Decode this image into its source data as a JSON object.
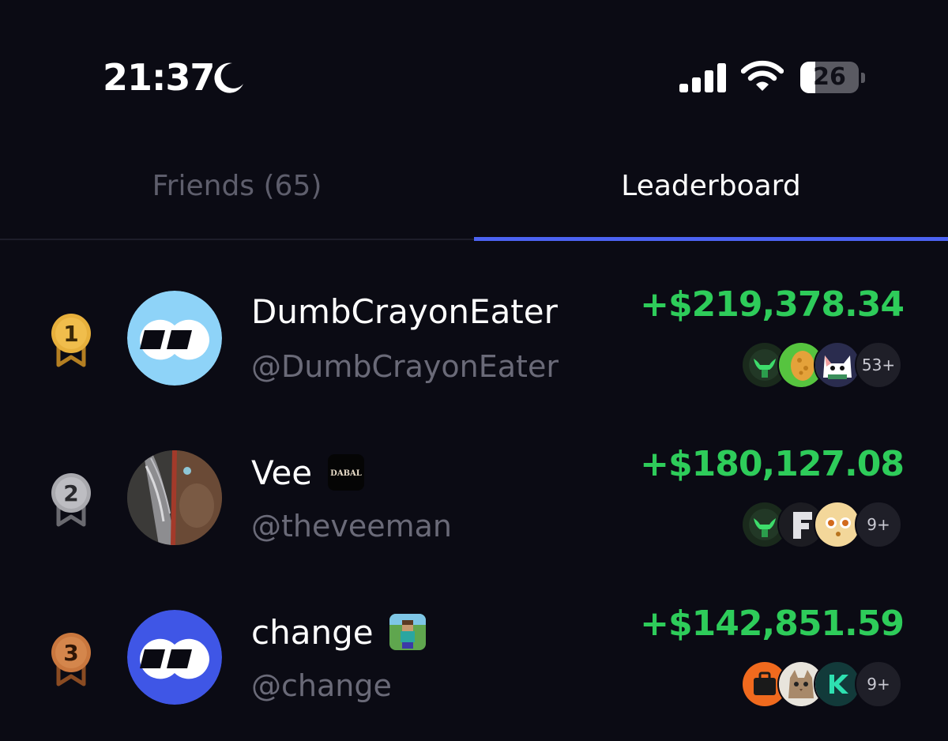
{
  "status_bar": {
    "time": "21:37",
    "moon_icon": "moon-icon",
    "signal_icon": "cellular-signal-icon",
    "wifi_icon": "wifi-icon",
    "battery_level": "26",
    "battery_percent": 26
  },
  "tabs": [
    {
      "label": "Friends (65)",
      "active": false
    },
    {
      "label": "Leaderboard",
      "active": true
    }
  ],
  "colors": {
    "background": "#0b0b14",
    "accent": "#4c63f2",
    "profit": "#2ecc5a",
    "muted_text": "#6a6a78",
    "gold": "#e7b03c",
    "silver": "#a9a9ae",
    "bronze": "#c9773e"
  },
  "leaderboard": [
    {
      "rank": "1",
      "medal": "gold-medal-icon",
      "name": "DumbCrayonEater",
      "handle": "@DumbCrayonEater",
      "pnl": "+$219,378.34",
      "more": "53+"
    },
    {
      "rank": "2",
      "medal": "silver-medal-icon",
      "name": "Vee",
      "badge": "DABAL",
      "handle": "@theveeman",
      "pnl": "+$180,127.08",
      "more": "9+"
    },
    {
      "rank": "3",
      "medal": "bronze-medal-icon",
      "name": "change",
      "handle": "@change",
      "pnl": "+$142,851.59",
      "more": "9+"
    }
  ]
}
